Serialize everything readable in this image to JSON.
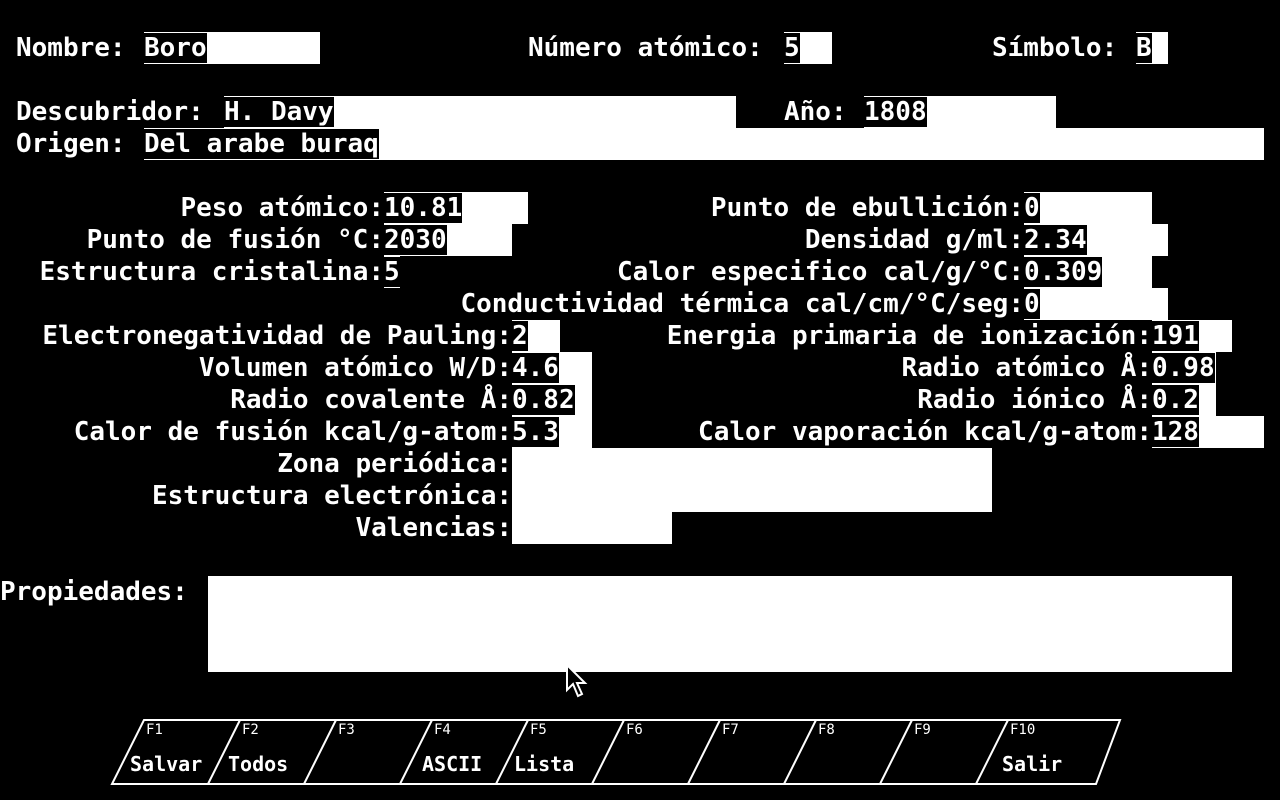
{
  "header": {
    "nombre_label": "Nombre:",
    "nombre_value": "Boro",
    "numero_label": "Número atómico:",
    "numero_value": "5",
    "simbolo_label": "Símbolo:",
    "simbolo_value": "B"
  },
  "info": {
    "descubridor_label": "Descubridor:",
    "descubridor_value": "H. Davy",
    "anio_label": "Año:",
    "anio_value": "1808",
    "origen_label": "Origen:",
    "origen_value": "Del arabe buraq"
  },
  "props": {
    "peso_label": "Peso atómico:",
    "peso_value": "10.81",
    "ebullicion_label": "Punto de ebullición:",
    "ebullicion_value": "0",
    "fusion_label": "Punto de fusión °C:",
    "fusion_value": "2030",
    "densidad_label": "Densidad g/ml:",
    "densidad_value": "2.34",
    "cristalina_label": "Estructura cristalina:",
    "cristalina_value": "5",
    "calor_esp_label": "Calor especifico cal/g/°C:",
    "calor_esp_value": "0.309",
    "conductividad_label": "Conductividad térmica cal/cm/°C/seg:",
    "conductividad_value": "0",
    "electroneg_label": "Electronegatividad de Pauling:",
    "electroneg_value": "2",
    "ionizacion_label": "Energia primaria de ionización:",
    "ionizacion_value": "191",
    "volumen_label": "Volumen atómico W/D:",
    "volumen_value": "4.6",
    "radio_atomico_label": "Radio atómico Å:",
    "radio_atomico_value": "0.98",
    "radio_cov_label": "Radio covalente Å:",
    "radio_cov_value": "0.82",
    "radio_ionico_label": "Radio iónico Å:",
    "radio_ionico_value": "0.2",
    "calor_fusion_label": "Calor de fusión kcal/g-atom:",
    "calor_fusion_value": "5.3",
    "calor_vap_label": "Calor vaporación kcal/g-atom:",
    "calor_vap_value": "128",
    "zona_label": "Zona periódica:",
    "zona_value": "",
    "estr_elec_label": "Estructura electrónica:",
    "estr_elec_value": "",
    "valencias_label": "Valencias:",
    "valencias_value": ""
  },
  "propiedades": {
    "label": "Propiedades:",
    "value": ""
  },
  "fkeys": [
    {
      "key": "F1",
      "label": "Salvar"
    },
    {
      "key": "F2",
      "label": "Todos"
    },
    {
      "key": "F3",
      "label": ""
    },
    {
      "key": "F4",
      "label": "ASCII"
    },
    {
      "key": "F5",
      "label": "Lista"
    },
    {
      "key": "F6",
      "label": ""
    },
    {
      "key": "F7",
      "label": ""
    },
    {
      "key": "F8",
      "label": ""
    },
    {
      "key": "F9",
      "label": ""
    },
    {
      "key": "F10",
      "label": "Salir"
    }
  ]
}
